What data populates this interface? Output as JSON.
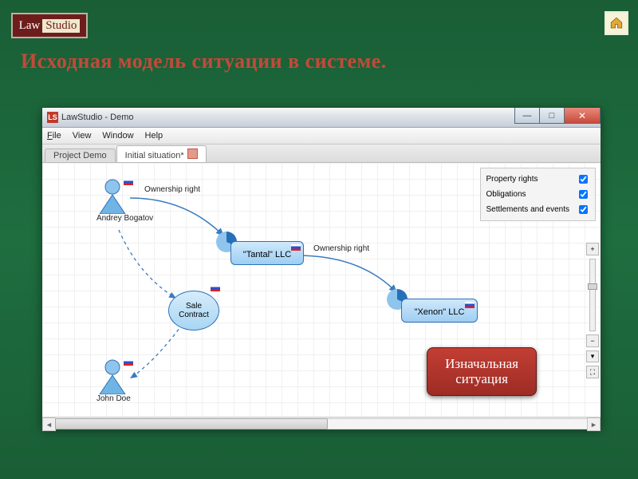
{
  "logo": {
    "part1": "Law",
    "part2": "Studio"
  },
  "page_title": "Исходная  модель ситуации в системе.",
  "window": {
    "title": "LawStudio - Demo",
    "icon_text": "LS",
    "menu": {
      "file": "File",
      "view": "View",
      "window": "Window",
      "help": "Help"
    },
    "tabs": [
      {
        "label": "Project Demo",
        "active": false
      },
      {
        "label": "Initial situation*",
        "active": true
      }
    ],
    "legend": {
      "property_rights": "Property rights",
      "obligations": "Obligations",
      "settlements": "Settlements and events"
    },
    "nodes": {
      "andrey": "Andrey Bogatov",
      "john": "John Doe",
      "sale": "Sale\nContract",
      "tantal": "\"Tantal\" LLC",
      "xenon": "\"Xenon\" LLC"
    },
    "edges": {
      "own1": "Ownership right",
      "own2": "Ownership right"
    }
  },
  "callout": {
    "line1": "Изначальная",
    "line2": "ситуация"
  }
}
